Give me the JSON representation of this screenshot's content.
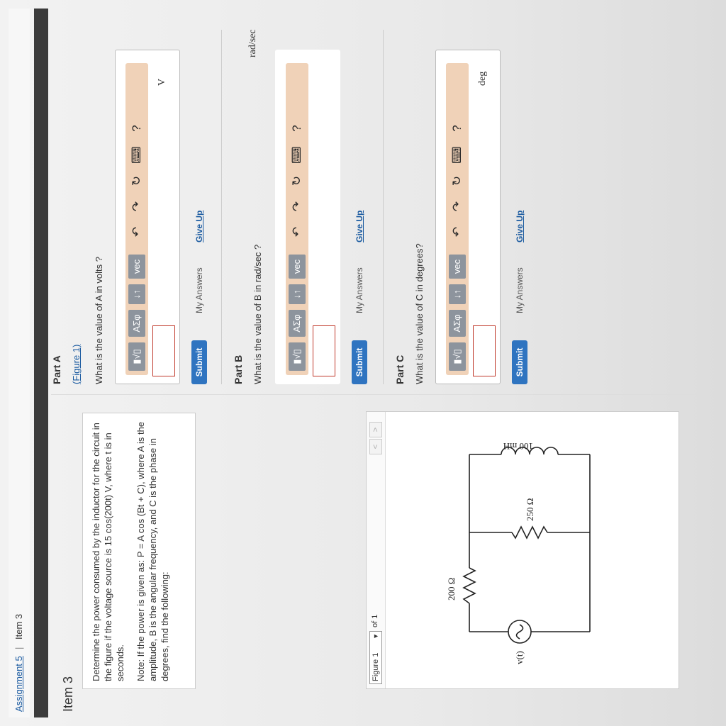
{
  "breadcrumb": {
    "assignment": "Assignment 5",
    "separator": "|",
    "current": "Item 3"
  },
  "item_title": "Item 3",
  "question": {
    "paragraph1": "Determine the power consumed by the inductor for the circuit in the figure if the voltage source is 15 cos(200t) V, where t is in seconds.",
    "paragraph2": "Note: If the power is given as: P = A cos (Bt + C), where A is the amplitude, B is the angular frequency, and C is the phase in degrees, find the following:"
  },
  "figure": {
    "selector_label": "Figure 1",
    "of_text": "of 1",
    "prev_label": "<",
    "next_label": ">",
    "source_label": "v(t)",
    "r1_label": "200 Ω",
    "r2_label": "250 Ω",
    "l_label": "100 mH"
  },
  "toolbar": {
    "templates_label": "▮√▯",
    "greek_label": "ΑΣφ",
    "arrows_label": "↓↑",
    "vec_label": "vec",
    "help_label": "?",
    "undo_icon": "undo-arrow-icon",
    "redo_icon": "redo-arrow-icon",
    "reset_icon": "reset-icon",
    "keyboard_icon": "keyboard-icon"
  },
  "parts": [
    {
      "title": "Part A",
      "figure_link": "(Figure 1)",
      "question": "What is the value of A in volts ?",
      "unit": "V",
      "submit": "Submit",
      "my_answers": "My Answers",
      "give_up": "Give Up"
    },
    {
      "title": "Part B",
      "question": "What is the value of B in rad/sec ?",
      "unit": "rad/sec",
      "submit": "Submit",
      "my_answers": "My Answers",
      "give_up": "Give Up"
    },
    {
      "title": "Part C",
      "question": "What is the value of C in degrees?",
      "unit": "deg",
      "submit": "Submit",
      "my_answers": "My Answers",
      "give_up": "Give Up"
    }
  ],
  "colors": {
    "link": "#1a5aa0",
    "submit": "#2f74c0",
    "toolbar_bg": "#f0d2b8",
    "input_border": "#c0392b"
  }
}
